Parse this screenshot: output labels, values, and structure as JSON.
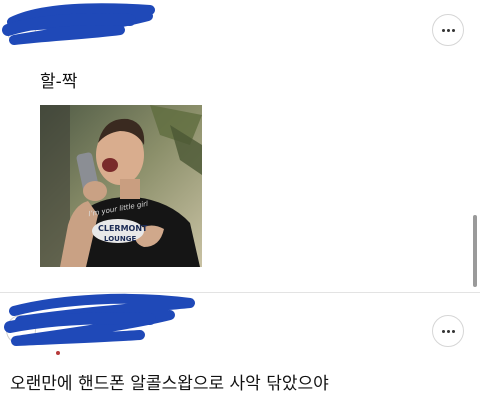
{
  "posts": [
    {
      "author_name": "",
      "text": "할-짝",
      "image": {
        "description": "man licking a smartphone",
        "shirt_text_line1": "I’m your little girl",
        "shirt_badge_text": "CLERMONT",
        "shirt_badge_sub": "LOUNGE"
      },
      "more_icon": "more-horizontal-icon"
    },
    {
      "author_name": "",
      "text": "오랜만에 핸드폰 알콜스왑으로 사악 닦았으야",
      "more_icon": "more-horizontal-icon"
    }
  ],
  "colors": {
    "redaction": "#1f49b8",
    "text": "#111111",
    "border": "#d6d6d6"
  }
}
